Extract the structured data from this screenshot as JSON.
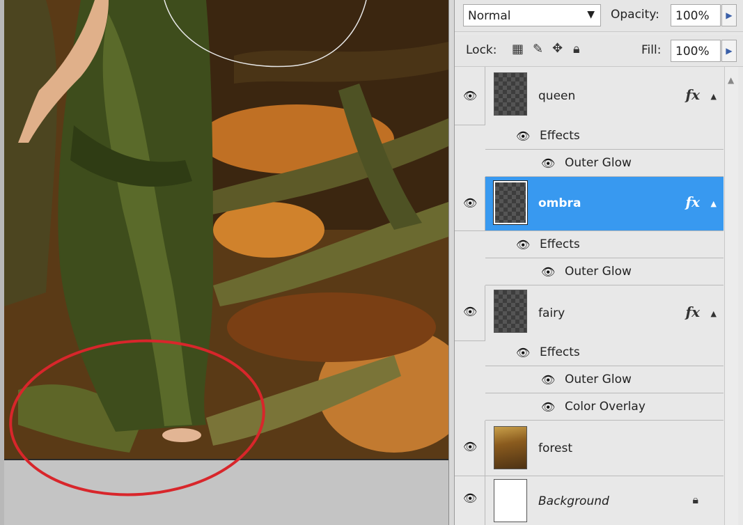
{
  "toolbar": {
    "blend_mode": "Normal",
    "opacity_label": "Opacity:",
    "opacity_value": "100%",
    "lock_label": "Lock:",
    "fill_label": "Fill:",
    "fill_value": "100%"
  },
  "layers": [
    {
      "name": "queen",
      "fx": "fx",
      "effects_label": "Effects",
      "effects": [
        "Outer Glow"
      ]
    },
    {
      "name": "ombra",
      "fx": "fx",
      "effects_label": "Effects",
      "effects": [
        "Outer Glow"
      ],
      "selected": true
    },
    {
      "name": "fairy",
      "fx": "fx",
      "effects_label": "Effects",
      "effects": [
        "Outer Glow",
        "Color Overlay"
      ]
    },
    {
      "name": "forest"
    },
    {
      "name": "Background",
      "locked": true
    }
  ],
  "colors": {
    "selection": "#3899f0",
    "annotation": "#d8262b"
  },
  "icons": {
    "visibility": "eye-icon",
    "lock": "lock-icon",
    "move": "move-icon",
    "brush": "brush-icon",
    "transparency_lock": "checker-lock-icon",
    "dropdown": "chevron-down-icon",
    "arrow_right": "arrow-right-icon"
  }
}
